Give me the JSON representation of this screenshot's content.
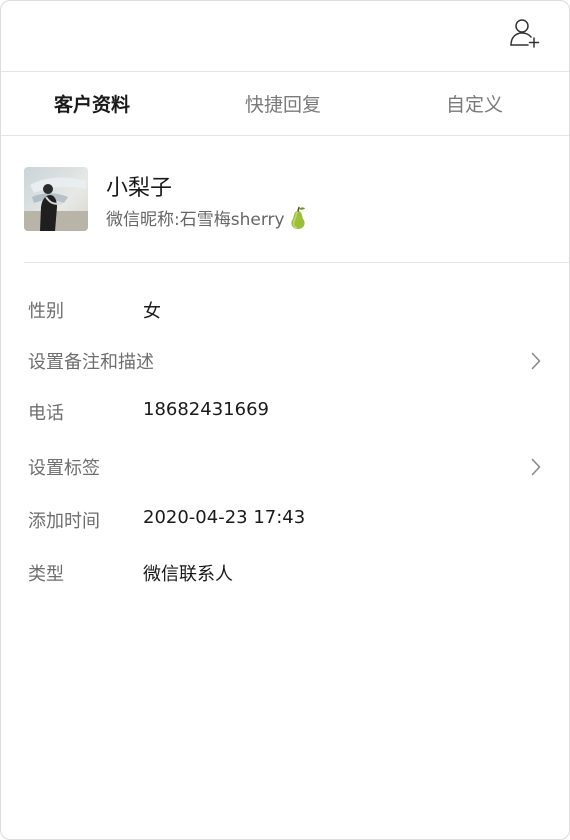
{
  "header": {
    "add_user_icon": "add-user-icon"
  },
  "tabs": [
    {
      "label": "客户资料",
      "active": true
    },
    {
      "label": "快捷回复",
      "active": false
    },
    {
      "label": "自定义",
      "active": false
    }
  ],
  "profile": {
    "name": "小梨子",
    "nickname_prefix": "微信昵称: ",
    "nickname": "石雪梅sherry",
    "nickname_emoji": "pear-emoji"
  },
  "fields": {
    "gender": {
      "label": "性别",
      "value": "女"
    },
    "remark": {
      "label": "设置备注和描述"
    },
    "phone": {
      "label": "电话",
      "value": "18682431669"
    },
    "tags": {
      "label": "设置标签"
    },
    "added_time": {
      "label": "添加时间",
      "value": "2020-04-23 17:43"
    },
    "type": {
      "label": "类型",
      "value": "微信联系人"
    }
  },
  "colors": {
    "text_primary": "#1a1a1a",
    "text_secondary": "#6e6e6e",
    "divider": "#e6e6e6",
    "pear": "#9bbf3a"
  }
}
